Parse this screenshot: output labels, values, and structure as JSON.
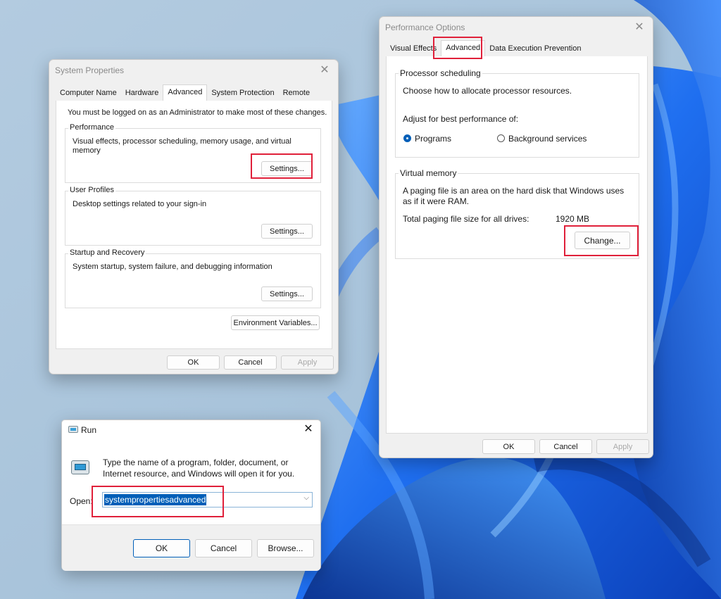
{
  "system_properties": {
    "title": "System Properties",
    "tabs": [
      "Computer Name",
      "Hardware",
      "Advanced",
      "System Protection",
      "Remote"
    ],
    "active_tab": "Advanced",
    "admin_note": "You must be logged on as an Administrator to make most of these changes.",
    "performance": {
      "label": "Performance",
      "description": "Visual effects, processor scheduling, memory usage, and virtual memory",
      "button": "Settings..."
    },
    "user_profiles": {
      "label": "User Profiles",
      "description": "Desktop settings related to your sign-in",
      "button": "Settings..."
    },
    "startup_recovery": {
      "label": "Startup and Recovery",
      "description": "System startup, system failure, and debugging information",
      "button": "Settings..."
    },
    "env_button": "Environment Variables...",
    "ok": "OK",
    "cancel": "Cancel",
    "apply": "Apply"
  },
  "performance_options": {
    "title": "Performance Options",
    "tabs": [
      "Visual Effects",
      "Advanced",
      "Data Execution Prevention"
    ],
    "active_tab": "Advanced",
    "processor_scheduling": {
      "label": "Processor scheduling",
      "description": "Choose how to allocate processor resources.",
      "adjust_label": "Adjust for best performance of:",
      "options": [
        "Programs",
        "Background services"
      ],
      "selected": "Programs"
    },
    "virtual_memory": {
      "label": "Virtual memory",
      "description": "A paging file is an area on the hard disk that Windows uses as if it were RAM.",
      "total_label": "Total paging file size for all drives:",
      "total_value": "1920 MB",
      "button": "Change..."
    },
    "ok": "OK",
    "cancel": "Cancel",
    "apply": "Apply"
  },
  "run_dialog": {
    "title": "Run",
    "description": "Type the name of a program, folder, document, or Internet resource, and Windows will open it for you.",
    "open_label": "Open:",
    "input_value": "systempropertiesadvanced",
    "ok": "OK",
    "cancel": "Cancel",
    "browse": "Browse..."
  },
  "colors": {
    "highlight": "#e0203a",
    "accent": "#005fb8",
    "wallpaper": "#1f5fe0"
  }
}
